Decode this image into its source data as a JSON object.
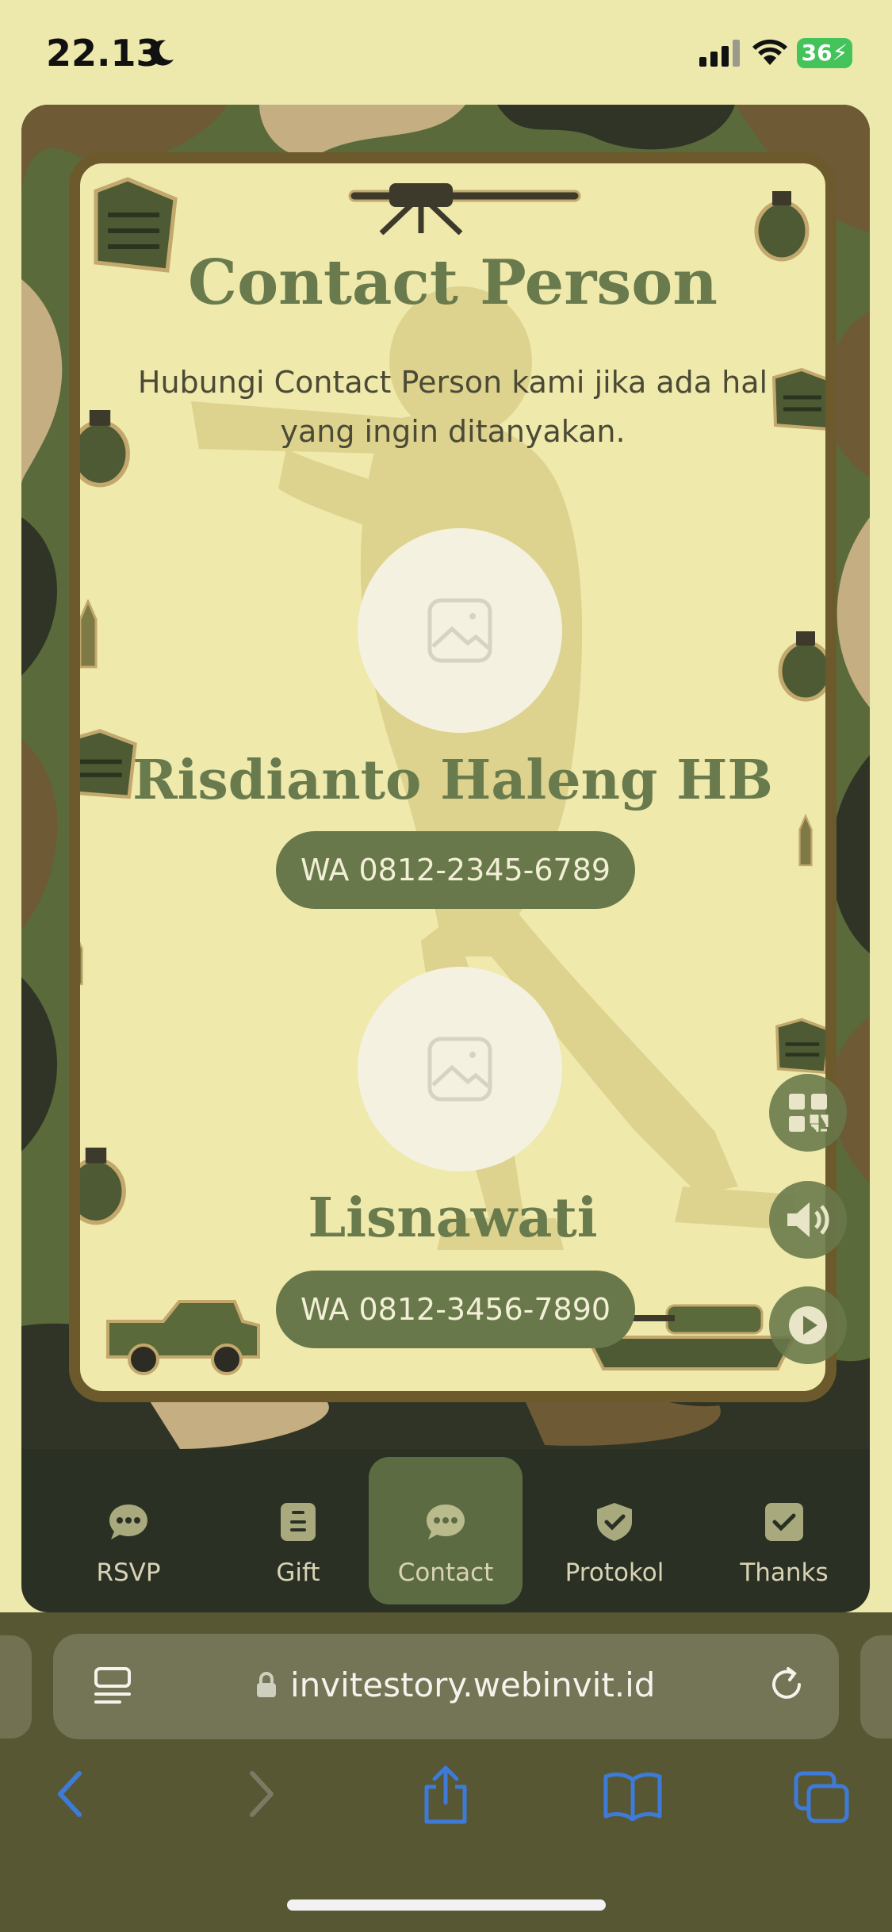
{
  "status": {
    "time": "22.13",
    "battery": "36"
  },
  "section": {
    "title": "Contact Person",
    "subtitle": "Hubungi Contact Person kami jika ada hal yang ingin ditanyakan."
  },
  "contacts": [
    {
      "name": "Risdianto Haleng HB",
      "wa_label": "WA 0812-2345-6789"
    },
    {
      "name": "Lisnawati",
      "wa_label": "WA 0812-3456-7890"
    }
  ],
  "nav": {
    "items": [
      {
        "label": "RSVP",
        "icon": "chat-bubble-icon"
      },
      {
        "label": "Gift",
        "icon": "gift-icon"
      },
      {
        "label": "Contact",
        "icon": "chat-bubble-icon",
        "active": true
      },
      {
        "label": "Protokol",
        "icon": "shield-check-icon"
      },
      {
        "label": "Thanks",
        "icon": "check-square-icon"
      }
    ]
  },
  "fabs": [
    "qr-code-icon",
    "speaker-icon",
    "play-icon"
  ],
  "browser": {
    "url": "invitestory.webinvit.id"
  },
  "colors": {
    "accent": "#68784a",
    "background": "#efe9ac",
    "nav": "#2a3024",
    "frame": "#6d5a2c",
    "ios_blue": "#3e7bd8"
  }
}
